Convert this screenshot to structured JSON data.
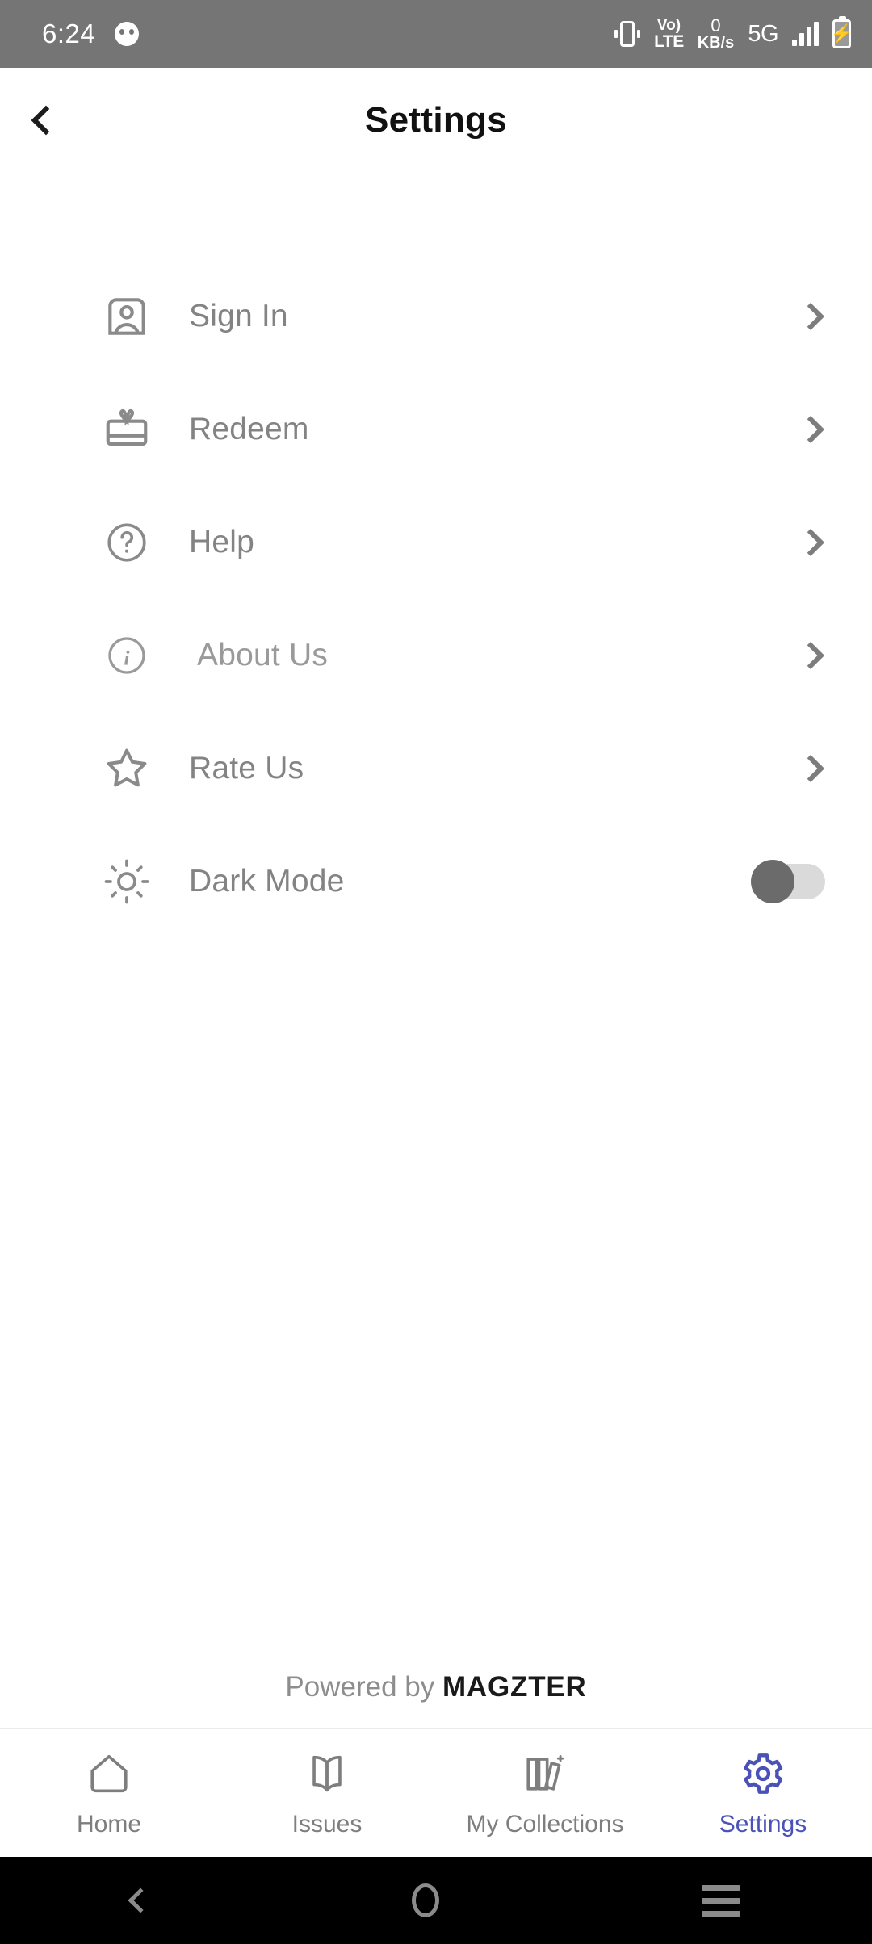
{
  "status_bar": {
    "time": "6:24",
    "face_icon": "face-icon",
    "vibrate_icon": "vibrate-icon",
    "volte_top": "Vo)",
    "volte_bottom": "LTE",
    "net_speed_value": "0",
    "net_speed_unit": "KB/s",
    "network_type": "5G",
    "signal_icon": "signal-bars-icon",
    "battery_icon": "battery-charging-icon"
  },
  "header": {
    "title": "Settings",
    "back_icon": "chevron-left-icon"
  },
  "settings_list": [
    {
      "label": "Sign In",
      "icon": "user-badge-icon",
      "accessory": "chevron-right-icon"
    },
    {
      "label": "Redeem",
      "icon": "gift-icon",
      "accessory": "chevron-right-icon"
    },
    {
      "label": "Help",
      "icon": "question-circle-icon",
      "accessory": "chevron-right-icon"
    },
    {
      "label": "About Us",
      "icon": "info-circle-icon",
      "accessory": "chevron-right-icon"
    },
    {
      "label": "Rate Us",
      "icon": "star-icon",
      "accessory": "chevron-right-icon"
    },
    {
      "label": "Dark Mode",
      "icon": "sun-icon",
      "accessory": "toggle-switch",
      "toggle_on": false
    }
  ],
  "footer": {
    "powered_prefix": "Powered by ",
    "brand": "MAGZTER"
  },
  "bottom_nav": {
    "active_color": "#4A52B8",
    "items": [
      {
        "label": "Home",
        "icon": "home-icon",
        "active": false
      },
      {
        "label": "Issues",
        "icon": "open-book-icon",
        "active": false
      },
      {
        "label": "My Collections",
        "icon": "books-sparkle-icon",
        "active": false
      },
      {
        "label": "Settings",
        "icon": "gear-icon",
        "active": true
      }
    ]
  },
  "android_nav": {
    "back_icon": "android-back-icon",
    "home_icon": "android-home-icon",
    "recents_icon": "android-recents-icon"
  }
}
